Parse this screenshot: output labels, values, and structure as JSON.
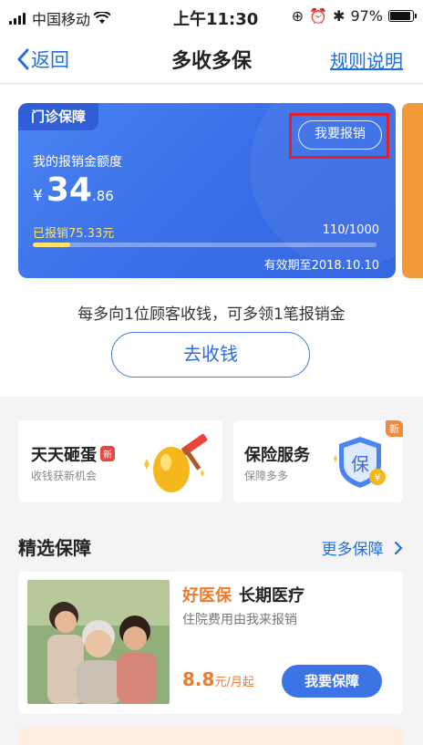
{
  "status_bar": {
    "carrier": "中国移动",
    "time": "上午11:30",
    "battery": "97%"
  },
  "nav": {
    "back_label": "返回",
    "title": "多收多保",
    "rules_label": "规则说明"
  },
  "card": {
    "tag": "门诊保障",
    "claim_button": "我要报销",
    "quota_label": "我的报销金额度",
    "currency": "¥",
    "amount_int": "34",
    "amount_dec": ".86",
    "claimed_text": "已报销75.33元",
    "progress_text": "110/1000",
    "progress_fraction": 0.11,
    "validity": "有效期至2018.10.10"
  },
  "promo": {
    "text": "每多向1位顾客收钱，可多领1笔报销金",
    "button": "去收钱"
  },
  "features": [
    {
      "title": "天天砸蛋",
      "badge": "新",
      "subtitle": "收钱获新机会",
      "icon": "golden-egg-hammer"
    },
    {
      "title": "保险服务",
      "corner_badge": "新",
      "subtitle": "保障多多",
      "icon": "shield-bao",
      "icon_text": "保"
    }
  ],
  "section": {
    "title": "精选保障",
    "more": "更多保障"
  },
  "product": {
    "brand": "好医保",
    "name": "长期医疗",
    "description": "住院费用由我来报销",
    "price_num": "8.8",
    "price_unit": "元/月起",
    "button": "我要保障",
    "image": "family-photo"
  },
  "colors": {
    "brand_blue": "#1f6fe0",
    "card_blue": "#3a6fe8",
    "highlight_red": "#e0202a",
    "accent_orange": "#f07a2c",
    "progress_yellow": "#ffe36c"
  }
}
